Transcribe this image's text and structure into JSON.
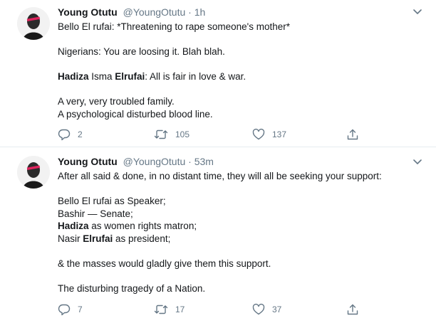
{
  "tweets": [
    {
      "name": "Young Otutu",
      "handle": "@YoungOtutu",
      "separator": "·",
      "time": "1h",
      "lines": [
        [
          {
            "text": "Bello El rufai: *Threatening to rape someone's mother*",
            "bold": false
          }
        ],
        [],
        [
          {
            "text": "Nigerians: You are loosing it. Blah blah.",
            "bold": false
          }
        ],
        [],
        [
          {
            "text": "Hadiza",
            "bold": true
          },
          {
            "text": " Isma ",
            "bold": false
          },
          {
            "text": "Elrufai",
            "bold": true
          },
          {
            "text": ": All is fair in love & war.",
            "bold": false
          }
        ],
        [],
        [
          {
            "text": "A very, very troubled family.",
            "bold": false
          }
        ],
        [
          {
            "text": "A psychological disturbed blood line.",
            "bold": false
          }
        ]
      ],
      "replies": "2",
      "retweets": "105",
      "likes": "137"
    },
    {
      "name": "Young Otutu",
      "handle": "@YoungOtutu",
      "separator": "·",
      "time": "53m",
      "lines": [
        [
          {
            "text": "After all said & done, in no distant time, they will all be seeking your support:",
            "bold": false
          }
        ],
        [],
        [
          {
            "text": "Bello El rufai as Speaker;",
            "bold": false
          }
        ],
        [
          {
            "text": "Bashir — Senate;",
            "bold": false
          }
        ],
        [
          {
            "text": "Hadiza",
            "bold": true
          },
          {
            "text": " as women rights matron;",
            "bold": false
          }
        ],
        [
          {
            "text": "Nasir ",
            "bold": false
          },
          {
            "text": "Elrufai",
            "bold": true
          },
          {
            "text": " as president;",
            "bold": false
          }
        ],
        [],
        [
          {
            "text": "& the masses would gladly give them this support.",
            "bold": false
          }
        ],
        [],
        [
          {
            "text": "The disturbing tragedy of a Nation.",
            "bold": false
          }
        ]
      ],
      "replies": "7",
      "retweets": "17",
      "likes": "37"
    }
  ],
  "icons": {
    "reply": "reply-icon",
    "retweet": "retweet-icon",
    "like": "heart-icon",
    "share": "share-icon",
    "caret": "chevron-down-icon"
  },
  "colors": {
    "text": "#14171a",
    "muted": "#657786",
    "divider": "#e6ecf0"
  }
}
